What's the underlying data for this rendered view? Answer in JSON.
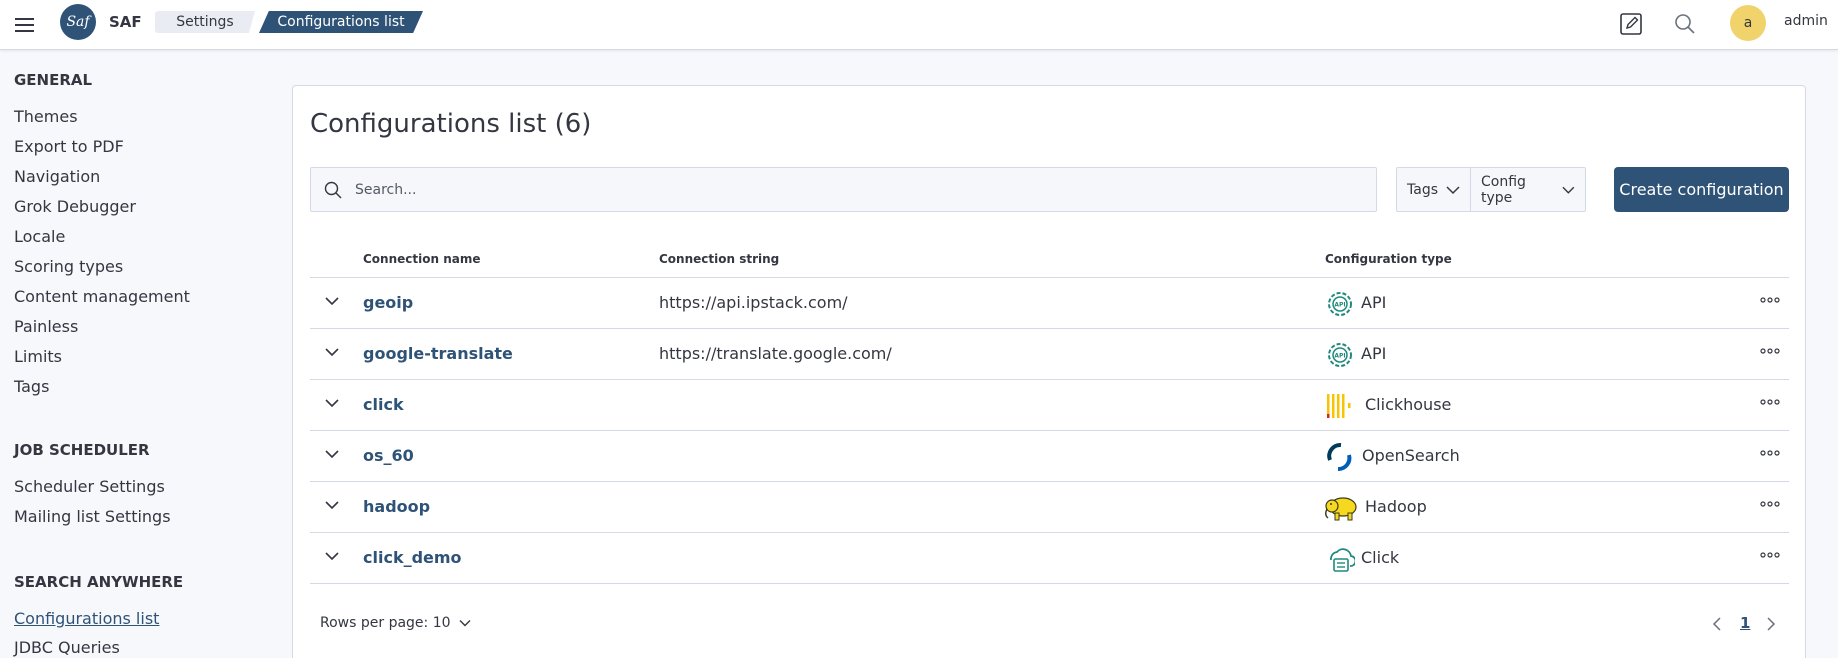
{
  "header": {
    "app_name": "SAF",
    "logo_text": "Saf",
    "breadcrumbs": [
      {
        "label": "Settings"
      },
      {
        "label": "Configurations list"
      }
    ],
    "user_initial": "a",
    "user_name": "admin",
    "icons": [
      "menu-icon",
      "edit-icon",
      "search-icon"
    ],
    "accent_color": "#2f5377",
    "avatar_color": "#f0d36a"
  },
  "sidebar": {
    "sections": [
      {
        "heading": "GENERAL",
        "items": [
          "Themes",
          "Export to PDF",
          "Navigation",
          "Grok Debugger",
          "Locale",
          "Scoring types",
          "Content management",
          "Painless",
          "Limits",
          "Tags"
        ]
      },
      {
        "heading": "JOB SCHEDULER",
        "items": [
          "Scheduler Settings",
          "Mailing list Settings"
        ]
      },
      {
        "heading": "SEARCH ANYWHERE",
        "items": [
          "Configurations list",
          "JDBC Queries"
        ]
      }
    ],
    "active_item": "Configurations list"
  },
  "main": {
    "title": "Configurations list (6)",
    "search_placeholder": "Search...",
    "filters": [
      "Tags",
      "Config type"
    ],
    "create_label": "Create configuration",
    "columns": [
      "Connection name",
      "Connection string",
      "Configuration type"
    ],
    "rows": [
      {
        "name": "geoip",
        "connection": "https://api.ipstack.com/",
        "type": "API",
        "icon": "api-icon"
      },
      {
        "name": "google-translate",
        "connection": "https://translate.google.com/",
        "type": "API",
        "icon": "api-icon"
      },
      {
        "name": "click",
        "connection": "",
        "type": "Clickhouse",
        "icon": "clickhouse-icon"
      },
      {
        "name": "os_60",
        "connection": "",
        "type": "OpenSearch",
        "icon": "opensearch-icon"
      },
      {
        "name": "hadoop",
        "connection": "",
        "type": "Hadoop",
        "icon": "hadoop-icon"
      },
      {
        "name": "click_demo",
        "connection": "",
        "type": "Click",
        "icon": "click-icon"
      }
    ],
    "pagination": {
      "rows_per_page": "Rows per page: 10",
      "current_page": "1"
    }
  }
}
